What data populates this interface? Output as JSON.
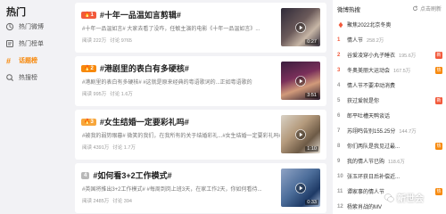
{
  "sidebar": {
    "title": "热门",
    "items": [
      {
        "label": "热门微博",
        "icon": "flame-icon"
      },
      {
        "label": "热门榜单",
        "icon": "list-icon"
      },
      {
        "label": "话题榜",
        "icon": "topic-icon",
        "active": true
      },
      {
        "label": "热搜榜",
        "icon": "search-rank-icon"
      }
    ]
  },
  "cards": [
    {
      "rank": "1",
      "title": "#十年一品温如言剪辑#",
      "desc": "#十年一品温如言# 大家去看了没咋，任敏主演的电影《十年一品温如言》...",
      "reads": "阅读 222万",
      "discuss": "讨论 9765",
      "duration": "0:27"
    },
    {
      "rank": "2",
      "title": "#港剧里的表白有多硬核#",
      "desc": "#港剧里的表白有多硬核# #这就是原来经典的粤语歌词的...正如粤语歌的",
      "reads": "阅读 995万",
      "discuss": "讨论 1.6万",
      "duration": "3:51"
    },
    {
      "rank": "3",
      "title": "#女生结婚一定要彩礼吗#",
      "desc": "#被我的弱势眼暮# 微笑的我们，在我所有的关于结婚彩礼...#女生结婚一定要彩礼吗#",
      "reads": "阅读 4391万",
      "discuss": "讨论 1.7万",
      "duration": "1:10"
    },
    {
      "rank": "4",
      "title": "#如何看3+2工作模式#",
      "desc": "#英国将推出3+2工作模式# #每周到岗上班3天，在家工作2天，你如何看待...",
      "reads": "阅读 2485万",
      "discuss": "讨论 394",
      "duration": "0:33"
    }
  ],
  "right_panel": {
    "title": "微博热搜",
    "refresh_label": "点击刷新",
    "rows": [
      {
        "rank": "",
        "text": "聚焦2022北京冬奥",
        "count": "",
        "flag": "",
        "pinned": true
      },
      {
        "rank": "1",
        "text": "情人节",
        "count": "258.2万",
        "flag": ""
      },
      {
        "rank": "2",
        "text": "谷爱凌穿小丸子睡衣",
        "count": "195.6万",
        "flag": "新"
      },
      {
        "rank": "3",
        "text": "冬奥美丽大运动会",
        "count": "167.5万",
        "flag": "热"
      },
      {
        "rank": "4",
        "text": "情人节不要冲动消费",
        "count": "",
        "flag": ""
      },
      {
        "rank": "5",
        "text": "获过爱就是你",
        "count": "",
        "flag": "新"
      },
      {
        "rank": "6",
        "text": "郎平吐槽天鸭谈话",
        "count": "",
        "flag": ""
      },
      {
        "rank": "7",
        "text": "苏翊鸣告别155.25分",
        "count": "144.7万",
        "flag": ""
      },
      {
        "rank": "8",
        "text": "你们两队是我见过最...",
        "count": "",
        "flag": "热"
      },
      {
        "rank": "9",
        "text": "我的情人节已购",
        "count": "118.6万",
        "flag": ""
      },
      {
        "rank": "10",
        "text": "张玉环获日后补偿近...",
        "count": "",
        "flag": ""
      },
      {
        "rank": "11",
        "text": "谭家事的情人节",
        "count": "",
        "flag": "热"
      },
      {
        "rank": "12",
        "text": "杨紫肖战的MV",
        "count": "",
        "flag": ""
      },
      {
        "rank": "13",
        "text": "冬奥会直播",
        "count": "",
        "flag": ""
      }
    ]
  },
  "watermark": "新世会"
}
